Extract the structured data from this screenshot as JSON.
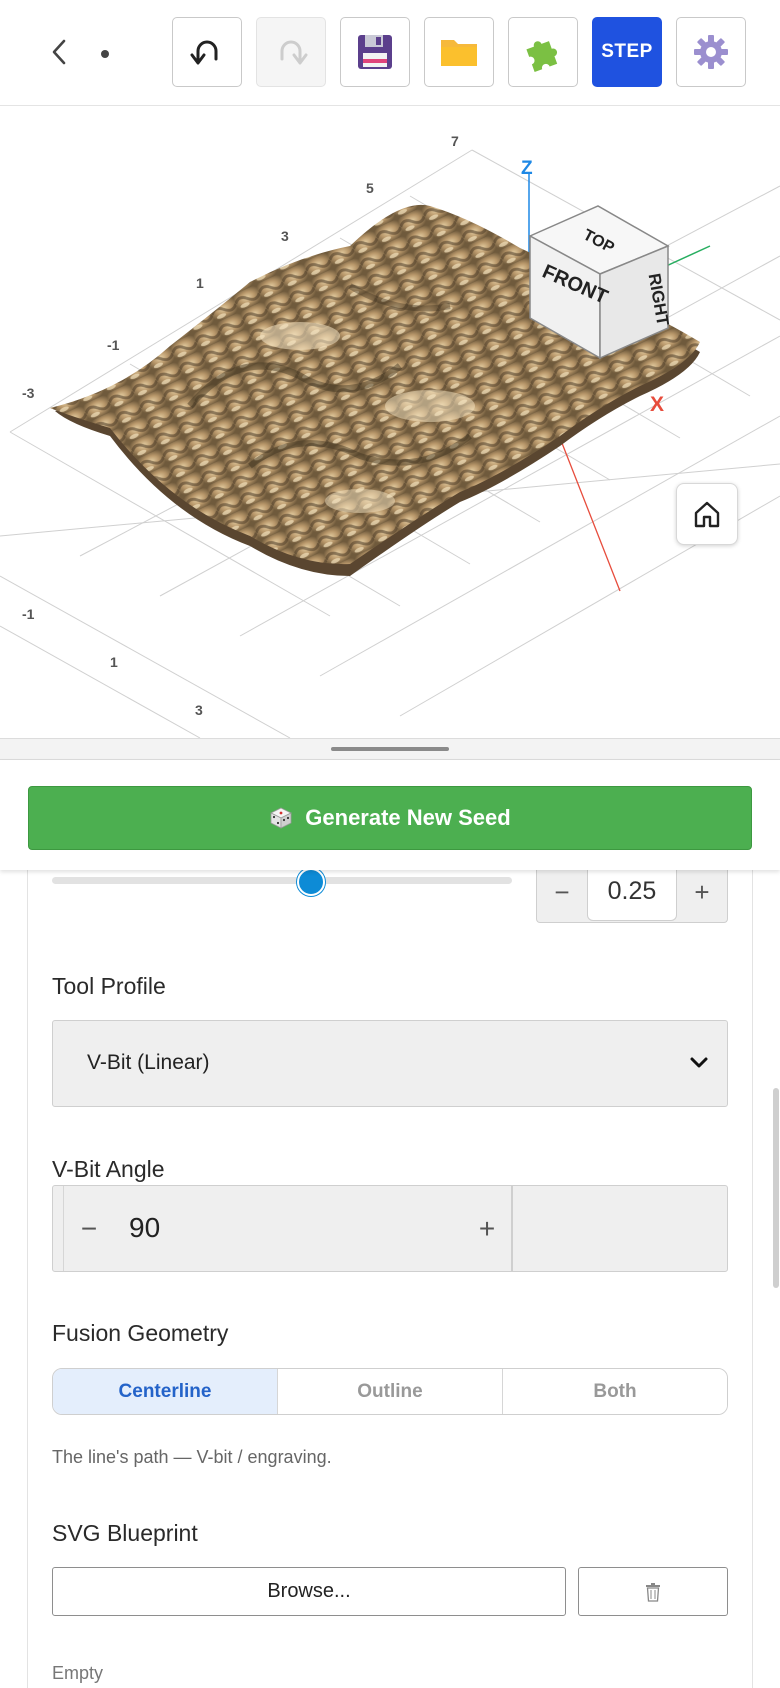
{
  "toolbar": {
    "back_icon": "chevron-left-icon",
    "buttons": [
      {
        "name": "undo",
        "icon": "undo-icon"
      },
      {
        "name": "redo",
        "icon": "redo-icon",
        "disabled": true
      },
      {
        "name": "save",
        "icon": "floppy-disk-icon"
      },
      {
        "name": "open",
        "icon": "folder-icon"
      },
      {
        "name": "plugins",
        "icon": "puzzle-piece-icon"
      },
      {
        "name": "step",
        "label": "STEP"
      },
      {
        "name": "settings",
        "icon": "gear-icon"
      }
    ],
    "step_label": "STEP",
    "step_color": "#1f52e0"
  },
  "viewport": {
    "grid_labels_back": [
      "7",
      "5",
      "3",
      "1",
      "-1",
      "-3"
    ],
    "grid_labels_front": [
      "-1",
      "1",
      "3"
    ],
    "axis_z": "Z",
    "axis_x": "X",
    "view_cube": {
      "top": "TOP",
      "front": "FRONT",
      "right": "RIGHT"
    },
    "home_icon": "home-icon",
    "terrain_color": "#c8a878"
  },
  "seed_button": {
    "icon": "dice-icon",
    "label": "Generate New Seed",
    "color": "#4caf50"
  },
  "slider": {
    "value": "0.25",
    "fraction": 0.55,
    "minus": "−",
    "plus": "+"
  },
  "tool_profile": {
    "label": "Tool Profile",
    "value": "V-Bit (Linear)"
  },
  "vbit_angle": {
    "label": "V-Bit Angle",
    "value": "90",
    "minus": "−",
    "plus": "+"
  },
  "fusion_geometry": {
    "label": "Fusion Geometry",
    "options": [
      "Centerline",
      "Outline",
      "Both"
    ],
    "selected": "Centerline",
    "hint": "The line's path — V-bit / engraving."
  },
  "svg_blueprint": {
    "label": "SVG Blueprint",
    "browse_label": "Browse...",
    "trash_icon": "trash-icon",
    "status": "Empty"
  }
}
